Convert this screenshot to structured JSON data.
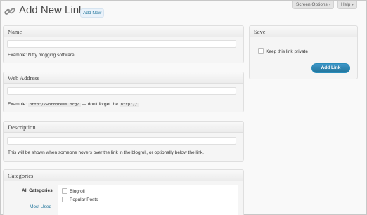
{
  "header": {
    "title": "Add New Link",
    "add_new_label": "Add New",
    "screen_options_label": "Screen Options",
    "help_label": "Help",
    "dropdown_arrow": "▾",
    "link_icon": "link-chain-icon"
  },
  "name_box": {
    "title": "Name",
    "value": "",
    "hint": "Example: Nifty blogging software"
  },
  "web_address_box": {
    "title": "Web Address",
    "value": "",
    "hint_prefix": "Example:",
    "hint_code1": "http://wordpress.org/",
    "hint_middle": "— don't forget the",
    "hint_code2": "http://"
  },
  "description_box": {
    "title": "Description",
    "value": "",
    "hint": "This will be shown when someone hovers over the link in the blogroll, or optionally below the link."
  },
  "categories_box": {
    "title": "Categories",
    "tabs": [
      "All Categories",
      "Most Used"
    ],
    "items": [
      {
        "label": "Blogroll",
        "checked": false
      },
      {
        "label": "Popular Posts",
        "checked": false
      }
    ]
  },
  "save_box": {
    "title": "Save",
    "private_label": "Keep this link private",
    "private_checked": false,
    "submit_label": "Add Link"
  },
  "colors": {
    "accent": "#21759b",
    "button": "#298cba",
    "background": "#f9f9f9"
  }
}
